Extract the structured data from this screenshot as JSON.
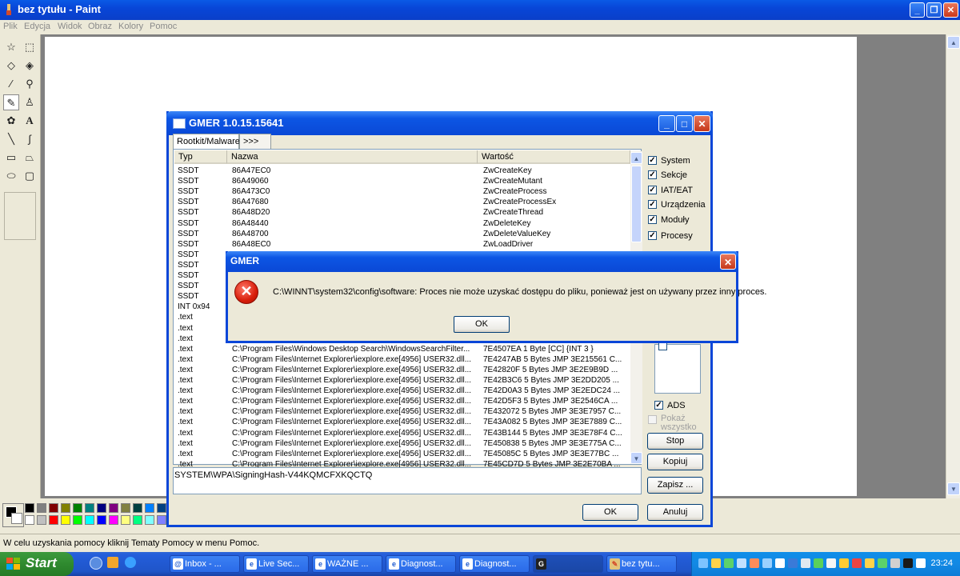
{
  "paint": {
    "title": "bez tytułu - Paint",
    "menu": [
      "Plik",
      "Edycja",
      "Widok",
      "Obraz",
      "Kolory",
      "Pomoc"
    ],
    "status": "W celu uzyskania pomocy kliknij Tematy Pomocy w menu Pomoc.",
    "palette_colors": [
      "#000000",
      "#808080",
      "#800000",
      "#808000",
      "#008000",
      "#008080",
      "#000080",
      "#800080",
      "#808040",
      "#004040",
      "#0080ff",
      "#004080",
      "#8000ff",
      "#804000",
      "#ffffff",
      "#c0c0c0",
      "#ff0000",
      "#ffff00",
      "#00ff00",
      "#00ffff",
      "#0000ff",
      "#ff00ff",
      "#ffff80",
      "#00ff80",
      "#80ffff",
      "#8080ff",
      "#ff0080",
      "#ff8040"
    ]
  },
  "gmer": {
    "title": "GMER 1.0.15.15641",
    "tabs": [
      "Rootkit/Malware",
      ">>>"
    ],
    "columns": [
      "Typ",
      "Nazwa",
      "Wartość"
    ],
    "rows": [
      [
        "SSDT",
        "86A47EC0",
        "ZwCreateKey"
      ],
      [
        "SSDT",
        "86A49060",
        "ZwCreateMutant"
      ],
      [
        "SSDT",
        "86A473C0",
        "ZwCreateProcess"
      ],
      [
        "SSDT",
        "86A47680",
        "ZwCreateProcessEx"
      ],
      [
        "SSDT",
        "86A48D20",
        "ZwCreateThread"
      ],
      [
        "SSDT",
        "86A48440",
        "ZwDeleteKey"
      ],
      [
        "SSDT",
        "86A48700",
        "ZwDeleteValueKey"
      ],
      [
        "SSDT",
        "86A48EC0",
        "ZwLoadDriver"
      ],
      [
        "SSDT",
        "",
        ""
      ],
      [
        "SSDT",
        "",
        ""
      ],
      [
        "SSDT",
        "",
        ""
      ],
      [
        "SSDT",
        "",
        ""
      ],
      [
        "SSDT",
        "",
        ""
      ],
      [
        "INT 0x94",
        "",
        ""
      ],
      [
        ".text",
        "",
        ""
      ],
      [
        ".text",
        "",
        ""
      ],
      [
        ".text",
        "",
        ""
      ],
      [
        ".text",
        "C:\\Program Files\\Windows Desktop Search\\WindowsSearchFilter...",
        "7E4507EA 1 Byte  [CC] {INT 3 }"
      ],
      [
        ".text",
        "C:\\Program Files\\Internet Explorer\\iexplore.exe[4956] USER32.dll...",
        "7E4247AB 5 Bytes  JMP 3E215561 C..."
      ],
      [
        ".text",
        "C:\\Program Files\\Internet Explorer\\iexplore.exe[4956] USER32.dll...",
        "7E42820F 5 Bytes  JMP 3E2E9B9D ..."
      ],
      [
        ".text",
        "C:\\Program Files\\Internet Explorer\\iexplore.exe[4956] USER32.dll...",
        "7E42B3C6 5 Bytes  JMP 3E2DD205 ..."
      ],
      [
        ".text",
        "C:\\Program Files\\Internet Explorer\\iexplore.exe[4956] USER32.dll...",
        "7E42D0A3 5 Bytes  JMP 3E2EDC24 ..."
      ],
      [
        ".text",
        "C:\\Program Files\\Internet Explorer\\iexplore.exe[4956] USER32.dll...",
        "7E42D5F3 5 Bytes  JMP 3E2546CA ..."
      ],
      [
        ".text",
        "C:\\Program Files\\Internet Explorer\\iexplore.exe[4956] USER32.dll...",
        "7E432072 5 Bytes  JMP 3E3E7957 C..."
      ],
      [
        ".text",
        "C:\\Program Files\\Internet Explorer\\iexplore.exe[4956] USER32.dll...",
        "7E43A082 5 Bytes  JMP 3E3E7889 C..."
      ],
      [
        ".text",
        "C:\\Program Files\\Internet Explorer\\iexplore.exe[4956] USER32.dll...",
        "7E43B144 5 Bytes  JMP 3E3E78F4 C..."
      ],
      [
        ".text",
        "C:\\Program Files\\Internet Explorer\\iexplore.exe[4956] USER32.dll...",
        "7E450838 5 Bytes  JMP 3E3E775A C..."
      ],
      [
        ".text",
        "C:\\Program Files\\Internet Explorer\\iexplore.exe[4956] USER32.dll...",
        "7E45085C 5 Bytes  JMP 3E3E77BC ..."
      ],
      [
        ".text",
        "C:\\Program Files\\Internet Explorer\\iexplore.exe[4956] USER32.dll...",
        "7E45CD7D 5 Bytes  JMP 3E2E70BA ..."
      ]
    ],
    "checkboxes": [
      {
        "label": "System",
        "checked": true
      },
      {
        "label": "Sekcje",
        "checked": true
      },
      {
        "label": "IAT/EAT",
        "checked": true
      },
      {
        "label": "Urządzenia",
        "checked": true
      },
      {
        "label": "Moduły",
        "checked": true
      },
      {
        "label": "Procesy",
        "checked": true
      }
    ],
    "ads": {
      "label": "ADS",
      "checked": true
    },
    "show_all": {
      "label1": "Pokaż",
      "label2": "wszystko",
      "checked": false
    },
    "buttons": {
      "stop": "Stop",
      "copy": "Kopiuj",
      "save": "Zapisz ...",
      "ok": "OK",
      "cancel": "Anuluj"
    },
    "path": "SYSTEM\\WPA\\SigningHash-V44KQMCFXKQCTQ"
  },
  "dialog": {
    "title": "GMER",
    "message": "C:\\WINNT\\system32\\config\\software: Proces nie może uzyskać dostępu do pliku, ponieważ jest on używany przez inny proces.",
    "ok": "OK"
  },
  "taskbar": {
    "start": "Start",
    "tasks": [
      "Inbox - ...",
      "Live Sec...",
      "WAŻNE ...",
      "Diagnost...",
      "Diagnost...",
      "",
      "bez tytu..."
    ],
    "clock": "23:24"
  }
}
